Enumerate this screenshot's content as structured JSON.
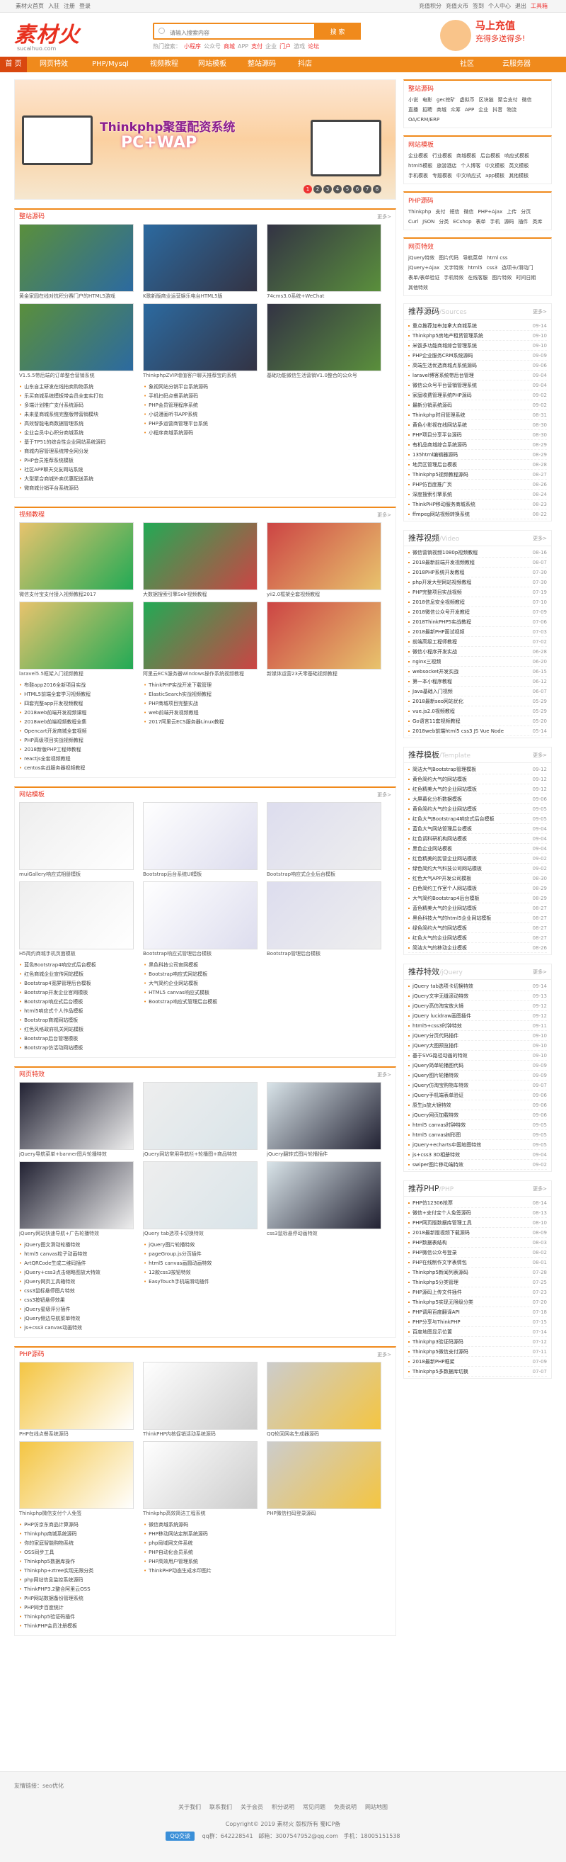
{
  "topbar": {
    "left": [
      "素材火首页",
      "入驻",
      "注册",
      "登录"
    ],
    "right": [
      "充值积分",
      "充值火币",
      "签到",
      "个人中心",
      "退出",
      "工具箱"
    ]
  },
  "logo": {
    "text": "素材火",
    "sub": "sucaihuo.com"
  },
  "search": {
    "placeholder": "请输入搜索内容",
    "button": "搜 索"
  },
  "hot": {
    "label": "热门搜索：",
    "items": [
      "小程序",
      "公众号",
      "商城",
      "APP",
      "支付",
      "企业",
      "门户",
      "游戏",
      "论坛"
    ]
  },
  "promo": {
    "t1": "马上充值",
    "t2": "充得多送得多!"
  },
  "nav": {
    "items": [
      "首 页",
      "网页特效",
      "PHP/Mysql",
      "视频教程",
      "网站模板",
      "整站源码",
      "抖店",
      "社区",
      "云服务器"
    ]
  },
  "slider": {
    "title": "Thinkphp聚蛋配资系统",
    "title2": "PC+WAP",
    "dots": [
      "1",
      "2",
      "3",
      "4",
      "5",
      "6",
      "7",
      "8"
    ]
  },
  "sections": [
    {
      "title": "整站源码",
      "more": "更多>",
      "cards": [
        "黄金家园在线对抗积分赛门户的HTML5游戏",
        "K歌新版商业运营娱乐电台HTML5版",
        "74cms3.0系统+WeChat",
        "V1.5.5带后端的订单整合营销系统",
        "ThinkphpZVIP增值客户聊天推荐宝的系统",
        "基础功能微信生活营销V1.0整合的公众号"
      ],
      "lists": [
        [
          "山东自主研发在线拍卖购物系统",
          "乐买商城系统模板带会员全套实打包",
          "多端计划推广支付系统源码",
          "未来星商城系统完整版带营销模块",
          "高效智能电商数据管理系统",
          "企业会员中心积分商城系统"
        ],
        [
          "象视网站分销平台系统源码",
          "手机扫码点餐系统源码",
          "PHP会员管理程序系统",
          "小说漫画听书APP系统",
          "PHP多运营商管理平台系统",
          "小程序商城系统源码"
        ],
        [
          "基于TP51的综合性企业网站系统源码",
          "商城内容管理系统带全网分发",
          "PHP会员推荐系统模板",
          "社区APP聊天交友网站系统",
          "大型聚合商城外卖优惠配送系统",
          "微商城分销平台系统源码"
        ]
      ]
    },
    {
      "title": "视频教程",
      "more": "更多>",
      "cards": [
        "微信支付宝支付接入视频教程2017",
        "大数据搜索引擎Solr视频教程",
        "yii2.0框架全套视频教程",
        "laravel5.5框架入门视频教程",
        "阿里云ECS服务器Windows操作系统视频教程",
        "新媒体运营23天零基础视频教程"
      ],
      "lists": [
        [
          "布鞋app2016全新项目实战",
          "HTML5前端全套学习视频教程",
          "四套完整app开发视频教程",
          "2018web前端开发视频课程",
          "2018web前端视频教程全集"
        ],
        [
          "ThinkPHP实战开发下载管理",
          "ElasticSearch实战视频教程",
          "PHP商城项目完整实战",
          "web前端开发视频教程",
          "2017阿里云ECS服务器Linux教程"
        ],
        [
          "Opencart开发商城全套视频",
          "PHP高级项目实战视频教程",
          "2018新版PHP工程师教程",
          "reactjs全套视频教程",
          "centos实战服务器视频教程"
        ]
      ]
    },
    {
      "title": "网站模板",
      "more": "更多>",
      "cards": [
        "muiGallery响应式相册模板",
        "Bootstrap后台系统UI模板",
        "Bootstrap响应式企业后台模板",
        "H5简约商城手机页面模板",
        "Bootstrap响应式管理后台模板",
        "Bootstrap管理后台模板"
      ],
      "lists": [
        [
          "蓝色Bootstrap4响应式后台模板",
          "红色商城企业宣传网站模板",
          "Bootstrap4宽屏管理后台模板",
          "Bootstrap开发企业官网模板",
          "Bootstrap响应式后台模板"
        ],
        [
          "黑色科技公司官网模板",
          "Bootstrap响应式网站模板",
          "大气简约企业网站模板",
          "HTML5 canvas响应式模板",
          "Bootstrap响应式管理后台模板"
        ],
        [
          "html5响应式个人作品模板",
          "Bootstrap商城网站模板",
          "红色风格政府机关网站模板",
          "Bootstrap后台管理模板",
          "Bootstrap仿活动网站模板"
        ]
      ]
    },
    {
      "title": "网页特效",
      "more": "更多>",
      "cards": [
        "jQuery导航菜单+banner图片轮播特效",
        "jQuery网站常用导航栏+轮播图+商品特效",
        "jQuery翻转式图片轮播插件",
        "jQuery网站快速导航+广告轮播特效",
        "jQuery tab选项卡切换特效",
        "css3鼠标悬停动画特效"
      ],
      "lists": [
        [
          "jQuery图文滑动轮播特效",
          "html5 canvas粒子动画特效",
          "ArtQRCode生成二维码插件",
          "jQuery+css3点击缩略图放大特效",
          "jQuery网页工具箱特效"
        ],
        [
          "jQuery图片轮播特效",
          "pageGroup.js分页插件",
          "html5 canvas画圆动画特效",
          "12款css3按钮特效",
          "EasyTouch手机端滑动插件"
        ],
        [
          "css3鼠标悬停图片特效",
          "css3按钮悬停效果",
          "jQuery星级评分插件",
          "jQuery侧边导航菜单特效",
          "js+css3 canvas动画特效"
        ]
      ]
    },
    {
      "title": "PHP源码",
      "more": "更多>",
      "cards": [
        "PHP在线点餐系统源码",
        "ThinkPHP内核促销活动系统源码",
        "QQ轮回网名生成器源码",
        "Thinkphp微信支付个人免签",
        "Thinkphp高效简洁工程系统",
        "PHP微信扫码登录源码"
      ],
      "lists": [
        [
          "PHP仿京东商品计算源码",
          "Thinkphp商城系统源码",
          "你的家庭智能购物系统",
          "OSS同步工具",
          "Thinkphp5数据库操作",
          "Thinkphp+ztree实现无限分类"
        ],
        [
          "微信商城系统源码",
          "PHP移动网站定制系统源码",
          "php局域网文件系统",
          "PHP自动化会员系统",
          "PHP高效用户管理系统",
          "ThinkPHP动态生成水印图片"
        ],
        [
          "php网站信息监控系统源码",
          "ThinkPHP3.2整合阿里云OSS",
          "PHP网站数据备份管理系统",
          "PHP同步百度统计",
          "Thinkphp5验证码插件",
          "ThinkPHP会员注册模板"
        ]
      ]
    }
  ],
  "sidebar": {
    "boxes": [
      {
        "title": "整站源码",
        "tags": [
          "小说",
          "电影",
          "gec挖矿",
          "虚拟币",
          "区块链",
          "聚合支付",
          "微信",
          "直播",
          "招聘",
          "商城",
          "众筹",
          "APP",
          "企业",
          "抖音",
          "物流",
          "OA/CRM/ERP"
        ]
      },
      {
        "title": "网站模板",
        "tags": [
          "企业模板",
          "行业模板",
          "商城模板",
          "后台模板",
          "响应式模板",
          "html5模板",
          "旅游酒店",
          "个人博客",
          "中文模板",
          "英文模板",
          "手机模板",
          "专题模板",
          "中文响应式",
          "app模板",
          "其他模板"
        ]
      },
      {
        "title": "PHP源码",
        "tags": [
          "Thinkphp",
          "支付",
          "短信",
          "微信",
          "PHP+Ajax",
          "上传",
          "分页",
          "Curl",
          "JSON",
          "分类",
          "ECshop",
          "表单",
          "手机",
          "源码",
          "插件",
          "类库"
        ]
      },
      {
        "title": "网页特效",
        "tags": [
          "jQuery特效",
          "图片代码",
          "导航菜单",
          "html css",
          "jQuery+Ajax",
          "文字特效",
          "html5",
          "css3",
          "选项卡/滑动门",
          "表单/表单验证",
          "手机特效",
          "在线客服",
          "图片特效",
          "时间日期",
          "其他特效"
        ]
      }
    ],
    "ranks": [
      {
        "title": "推荐源码",
        "en": "/Sources",
        "more": "更多>",
        "items": [
          [
            "重点推荐加布加拿大商城系统",
            "09-14"
          ],
          [
            "Thinkphp5房地产租赁管理系统",
            "09-10"
          ],
          [
            "米饭多功能商城综合管理系统",
            "09-10"
          ],
          [
            "PHP企业服务CRM系统源码",
            "09-09"
          ],
          [
            "高端生活优选商城点系统源码",
            "09-06"
          ],
          [
            "laravel博客系统带后台管理",
            "09-04"
          ],
          [
            "微信公众号平台营销管理系统",
            "09-04"
          ],
          [
            "家庭收费管理系统PHP源码",
            "09-02"
          ],
          [
            "最新分销系统源码",
            "09-02"
          ],
          [
            "Thinkphp时间管理系统",
            "08-31"
          ],
          [
            "黄色小影视在线网站系统",
            "08-30"
          ],
          [
            "PHP项目分享平台源码",
            "08-30"
          ],
          [
            "有机品商城综合系统源码",
            "08-29"
          ],
          [
            "135html编辑器源码",
            "08-29"
          ],
          [
            "地灵区管理后台模板",
            "08-28"
          ],
          [
            "Thinkphp5视频教程源码",
            "08-27"
          ],
          [
            "PHP仿百度推广页",
            "08-26"
          ],
          [
            "深度搜索引擎系统",
            "08-24"
          ],
          [
            "ThinkPHP移动服务商城系统",
            "08-23"
          ],
          [
            "ffmpeg网站视频转换系统",
            "08-22"
          ]
        ]
      },
      {
        "title": "推荐视频",
        "en": "/Video",
        "more": "更多>",
        "items": [
          [
            "微信营销视频1080p视频教程",
            "08-16"
          ],
          [
            "2018最新前端开发视频教程",
            "08-07"
          ],
          [
            "2018PHP系统开发教程",
            "07-30"
          ],
          [
            "php开发大型网站视频教程",
            "07-30"
          ],
          [
            "PHP完整项目实战视频",
            "07-19"
          ],
          [
            "2018信息安全视频教程",
            "07-10"
          ],
          [
            "2018微信公众号开发教程",
            "07-09"
          ],
          [
            "2018ThinkPHP5实战教程",
            "07-06"
          ],
          [
            "2018最新PHP面试视频",
            "07-03"
          ],
          [
            "前端高级工程师教程",
            "07-02"
          ],
          [
            "微信小程序开发实战",
            "06-28"
          ],
          [
            "nginx三视频",
            "06-20"
          ],
          [
            "websocket开发实战",
            "06-15"
          ],
          [
            "第一本小程序教程",
            "06-12"
          ],
          [
            "Java基础入门视频",
            "06-07"
          ],
          [
            "2018最新seo网站优化",
            "05-29"
          ],
          [
            "vue.js2.0视频教程",
            "05-29"
          ],
          [
            "Go语言11套视频教程",
            "05-20"
          ],
          [
            "2018web前端html5 css3 JS Vue Node",
            "05-14"
          ]
        ]
      },
      {
        "title": "推荐模板",
        "en": "/Template",
        "more": "更多>",
        "items": [
          [
            "简洁大气Bootstrap管理模板",
            "09-12"
          ],
          [
            "黄色简约大气的网站模板",
            "09-12"
          ],
          [
            "红色精美大气的企业网站模板",
            "09-12"
          ],
          [
            "大屏幕化分析数据模板",
            "09-06"
          ],
          [
            "黄色简约大气的企业网站模板",
            "09-05"
          ],
          [
            "红色大气Bootstrap4响应式后台模板",
            "09-05"
          ],
          [
            "蓝色大气网站管理后台模板",
            "09-04"
          ],
          [
            "红色调科研机构网站模板",
            "09-04"
          ],
          [
            "黑色企业网站模板",
            "09-04"
          ],
          [
            "红色精美的民营企业网站模板",
            "09-02"
          ],
          [
            "绿色简约大气科技公司网站模板",
            "09-02"
          ],
          [
            "红色大气APP开发公司模板",
            "08-30"
          ],
          [
            "白色简约工作室个人网站模板",
            "08-29"
          ],
          [
            "大气简约Bootstrap4后台模板",
            "08-29"
          ],
          [
            "蓝色精美大气的企业网站模板",
            "08-27"
          ],
          [
            "黑色科技大气的html5企业网站模板",
            "08-27"
          ],
          [
            "绿色简约大气的网站模板",
            "08-27"
          ],
          [
            "红色大气的企业网站模板",
            "08-27"
          ],
          [
            "简洁大气的移动企业模板",
            "08-26"
          ]
        ]
      },
      {
        "title": "推荐特效",
        "en": "/jQuery",
        "more": "更多>",
        "items": [
          [
            "jQuery tab选项卡切换特效",
            "09-14"
          ],
          [
            "jQuery文字无缝滚动特效",
            "09-13"
          ],
          [
            "jQuery高仿淘宝放大镜",
            "09-12"
          ],
          [
            "jQuery lucidraw画图插件",
            "09-12"
          ],
          [
            "html5+css3时钟特效",
            "09-11"
          ],
          [
            "jQuery分页代码插件",
            "09-10"
          ],
          [
            "jQuery大图预览插件",
            "09-10"
          ],
          [
            "基于SVG路径动画的特效",
            "09-10"
          ],
          [
            "jQuery简单轮播图代码",
            "09-09"
          ],
          [
            "jQuery图片轮播特效",
            "09-09"
          ],
          [
            "jQuery仿淘宝购物车特效",
            "09-07"
          ],
          [
            "jQuery手机端表单验证",
            "09-06"
          ],
          [
            "原生js放大镜特效",
            "09-06"
          ],
          [
            "jQuery网页加载特效",
            "09-06"
          ],
          [
            "html5 canvas时钟特效",
            "09-05"
          ],
          [
            "html5 canvas树形图",
            "09-05"
          ],
          [
            "jQuery+echarts中国地图特效",
            "09-05"
          ],
          [
            "js+css3 3D相册特效",
            "09-04"
          ],
          [
            "swiper图片移动端特效",
            "09-02"
          ]
        ]
      },
      {
        "title": "推荐PHP",
        "en": "/PHP",
        "more": "更多>",
        "items": [
          [
            "PHP仿12306抢票",
            "08-14"
          ],
          [
            "微信+支付宝个人免签源码",
            "08-13"
          ],
          [
            "PHP网页版数据库管理工具",
            "08-10"
          ],
          [
            "2018最新版视频下载源码",
            "08-09"
          ],
          [
            "PHP数据表结构",
            "08-03"
          ],
          [
            "PHP微信公众号登录",
            "08-02"
          ],
          [
            "PHP在线制作文字表情包",
            "08-01"
          ],
          [
            "Thinkphp5新闻列表源码",
            "07-28"
          ],
          [
            "Thinkphp5分类管理",
            "07-25"
          ],
          [
            "PHP源码上传文件插件",
            "07-23"
          ],
          [
            "Thinkphp5实现无限级分类",
            "07-20"
          ],
          [
            "PHP调用百度翻译API",
            "07-18"
          ],
          [
            "PHP分享与ThinkPHP",
            "07-15"
          ],
          [
            "百度地图显示位置",
            "07-14"
          ],
          [
            "Thinkphp3验证码源码",
            "07-12"
          ],
          [
            "Thinkphp5微信支付源码",
            "07-11"
          ],
          [
            "2018最新PHP框架",
            "07-09"
          ],
          [
            "Thinkphp5多数据库切换",
            "07-07"
          ]
        ]
      }
    ]
  },
  "footer": {
    "friend": "友情链接：",
    "friend_link": "seo优化",
    "links": [
      "关于我们",
      "联系我们",
      "关于会员",
      "积分说明",
      "常见问题",
      "免责说明",
      "网站地图"
    ],
    "copyright": "Copyright© 2019 素材火 版权所有 蜀ICP备",
    "qq_badge": "QQ交谈",
    "qq": "qq群：642228541",
    "email": "邮箱：3007547952@qq.com",
    "phone": "手机：18005151538"
  }
}
